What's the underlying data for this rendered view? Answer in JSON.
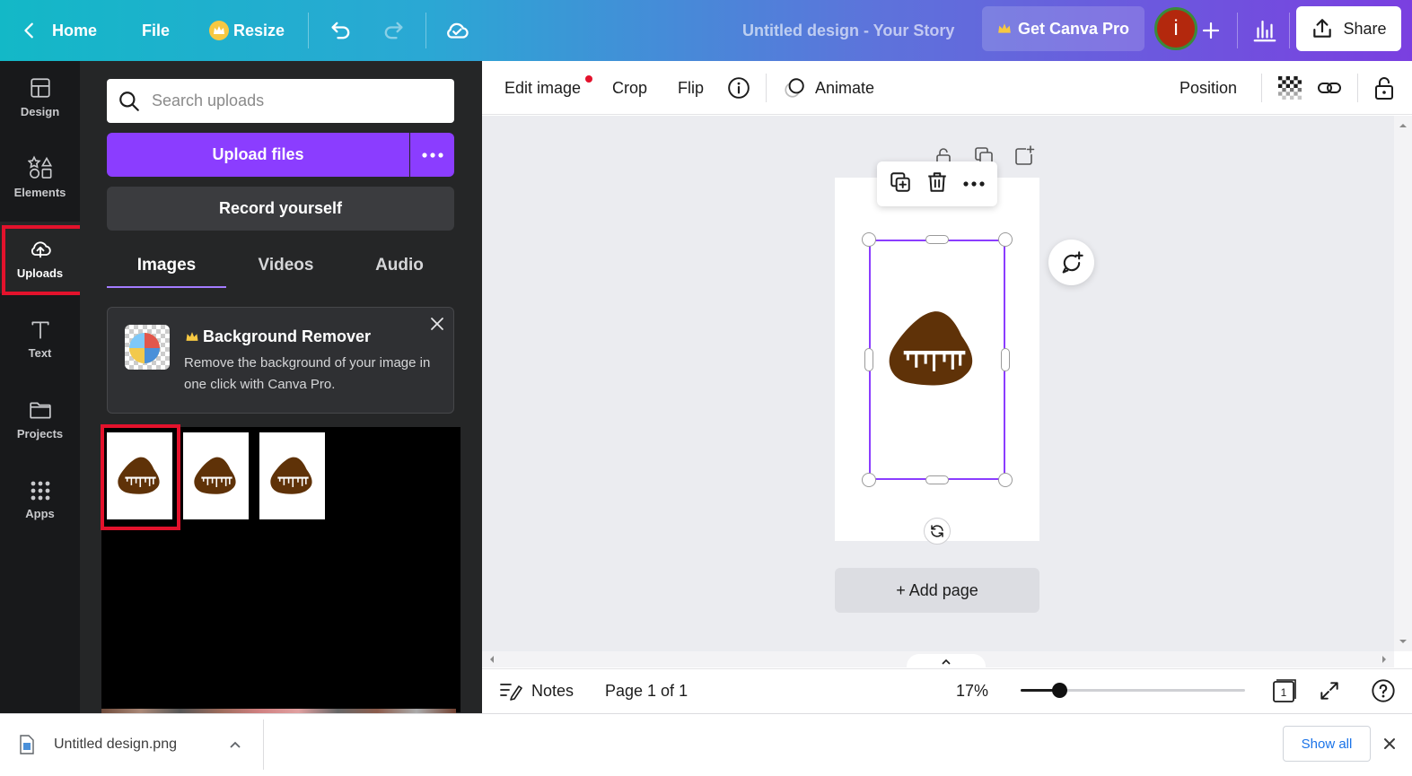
{
  "topbar": {
    "home_label": "Home",
    "file_label": "File",
    "resize_label": "Resize",
    "document_title": "Untitled design - Your Story",
    "pro_label": "Get Canva Pro",
    "avatar_initial": "i",
    "share_label": "Share"
  },
  "rail": {
    "items": [
      {
        "label": "Design",
        "icon": "layout-icon"
      },
      {
        "label": "Elements",
        "icon": "shapes-icon"
      },
      {
        "label": "Uploads",
        "icon": "cloud-upload-icon"
      },
      {
        "label": "Text",
        "icon": "text-icon"
      },
      {
        "label": "Projects",
        "icon": "folder-icon"
      },
      {
        "label": "Apps",
        "icon": "grid-icon"
      }
    ],
    "active": "Uploads"
  },
  "panel": {
    "search_placeholder": "Search uploads",
    "upload_label": "Upload files",
    "record_label": "Record yourself",
    "tabs": [
      "Images",
      "Videos",
      "Audio"
    ],
    "active_tab": "Images",
    "promo": {
      "title": "Background Remover",
      "description": "Remove the background of your image in one click with Canva Pro."
    },
    "thumbnail_count": 3
  },
  "context_toolbar": {
    "edit_image_label": "Edit image",
    "crop_label": "Crop",
    "flip_label": "Flip",
    "animate_label": "Animate",
    "position_label": "Position"
  },
  "canvas": {
    "add_page_label": "+ Add page"
  },
  "bottom_bar": {
    "notes_label": "Notes",
    "page_indicator": "Page 1 of 1",
    "zoom_level": "17%",
    "zoom_fraction": 0.17,
    "page_count": "1"
  },
  "download_bar": {
    "file_name": "Untitled design.png",
    "show_all_label": "Show all"
  },
  "colors": {
    "accent_purple": "#8b3dff",
    "highlight_red": "#e3122c",
    "blob_brown": "#5f3208"
  }
}
